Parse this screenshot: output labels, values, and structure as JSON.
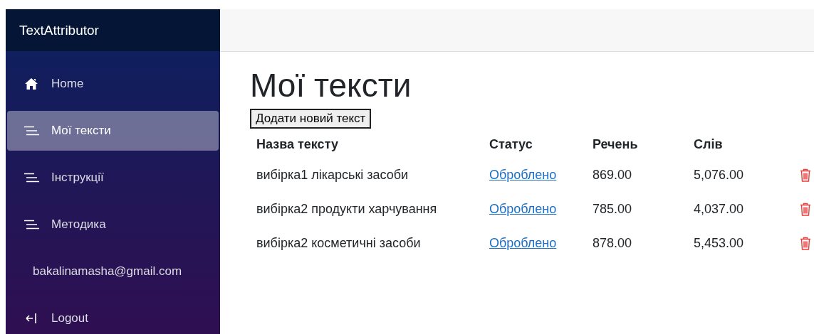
{
  "sidebar": {
    "brand": "TextAttributor",
    "items": [
      {
        "kind": "home",
        "label": "Home",
        "selected": false
      },
      {
        "kind": "list",
        "label": "Мої тексти",
        "selected": true
      },
      {
        "kind": "list",
        "label": "Інструкції",
        "selected": false
      },
      {
        "kind": "list",
        "label": "Методика",
        "selected": false
      },
      {
        "kind": "user",
        "label": "bakalinamasha@gmail.com",
        "selected": false
      },
      {
        "kind": "logout",
        "label": "Logout",
        "selected": false
      }
    ]
  },
  "page": {
    "title": "Мої тексти",
    "add_button": "Додати новий текст"
  },
  "table": {
    "columns": [
      "Назва тексту",
      "Статус",
      "Речень",
      "Слів"
    ],
    "rows": [
      {
        "name": "вибірка1 лікарські засоби",
        "status": "Оброблено",
        "sentences": "869.00",
        "words": "5,076.00"
      },
      {
        "name": "вибірка2 продукти харчування",
        "status": "Оброблено",
        "sentences": "785.00",
        "words": "4,037.00"
      },
      {
        "name": "вибірка2 косметичні засоби",
        "status": "Оброблено",
        "sentences": "878.00",
        "words": "5,453.00"
      }
    ]
  }
}
